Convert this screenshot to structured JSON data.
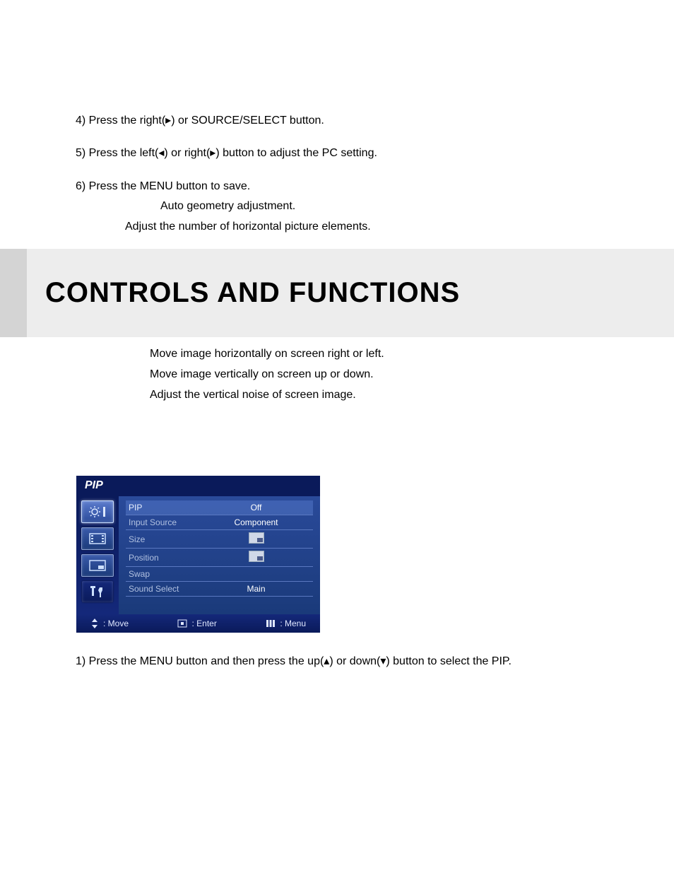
{
  "intro": {
    "step4": "4) Press the right(▸) or SOURCE/SELECT button.",
    "step5": "5) Press the left(◂) or right(▸) button to adjust the PC setting.",
    "step6": "6) Press the MENU button to save.",
    "sub1": "Auto geometry adjustment.",
    "sub2": "Adjust the number of horizontal picture elements."
  },
  "banner": {
    "title": "CONTROLS AND FUNCTIONS"
  },
  "post": {
    "l1": "Move image horizontally on screen right or left.",
    "l2": "Move image vertically on screen up or down.",
    "l3": "Adjust the vertical noise of screen image."
  },
  "osd": {
    "title": "PIP",
    "rows": [
      {
        "label": "PIP",
        "value": "Off",
        "selected": true,
        "type": "text"
      },
      {
        "label": "Input Source",
        "value": "Component",
        "type": "text"
      },
      {
        "label": "Size",
        "type": "box"
      },
      {
        "label": "Position",
        "type": "box"
      },
      {
        "label": "Swap",
        "value": "",
        "type": "text"
      },
      {
        "label": "Sound Select",
        "value": "Main",
        "type": "text"
      }
    ],
    "hints": {
      "move": ": Move",
      "enter": ": Enter",
      "menu": ": Menu"
    }
  },
  "bottom": {
    "step1": "1) Press the MENU button and then press the up(▴) or down(▾) button to select the PIP."
  }
}
